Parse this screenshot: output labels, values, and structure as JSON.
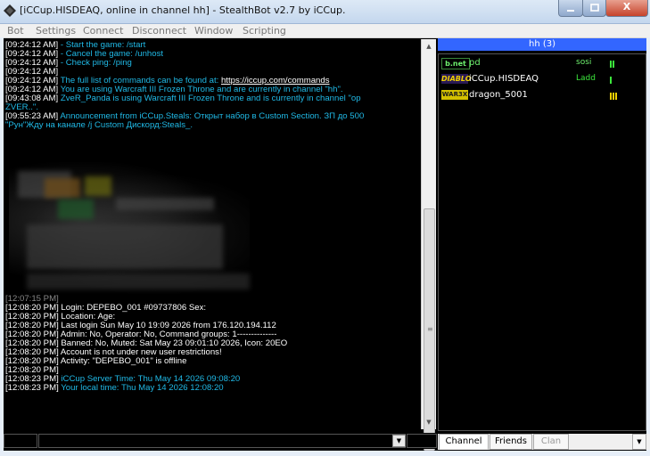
{
  "window": {
    "title": "[iCCup.HISDEAQ, online in channel hh] - StealthBot v2.7 by iCCup.",
    "min_label": "",
    "max_label": "",
    "close_label": "X"
  },
  "menu": [
    "Bot",
    "Settings",
    "Connect",
    "Disconnect",
    "Window",
    "Scripting"
  ],
  "chat": {
    "lines": [
      {
        "ts": "[09:24:12 AM]",
        "text": " - Start the game: /start",
        "color": "cyan"
      },
      {
        "ts": "[09:24:12 AM]",
        "text": " - Cancel the game: /unhost",
        "color": "cyan"
      },
      {
        "ts": "[09:24:12 AM]",
        "text": " - Check ping: /ping",
        "color": "cyan"
      },
      {
        "ts": "[09:24:12 AM]",
        "text": "",
        "color": "cyan"
      },
      {
        "ts": "[09:24:12 AM]",
        "text": " The full list of commands can be found at: ",
        "color": "cyan",
        "link": "https://iccup.com/commands"
      },
      {
        "ts": "[09:24:12 AM]",
        "text": " You are using Warcraft III Frozen Throne and are currently in channel \"hh\".",
        "color": "cyan"
      },
      {
        "ts": "[09:43:08 AM]",
        "text": " ZveR_Panda is using Warcraft III Frozen Throne and is currently in channel \"op",
        "color": "cyan"
      },
      {
        "ts": "",
        "text": "  ZVER..\".",
        "color": "cyan"
      },
      {
        "ts": "[09:55:23 AM]",
        "text": " Announcement from iCCup.Steals: Открыт набор в Custom Section. ЗП до 500",
        "color": "cyan"
      },
      {
        "ts": "",
        "text": "  \"Рун\"Жду на канале /j Custom  Дискорд:Steals_.",
        "color": "cyan"
      },
      {
        "ts": "[12:07:15 PM]",
        "text": "",
        "color": "cyan"
      },
      {
        "ts": "[12:08:20 PM]",
        "text": " Login: DEPEBO_001       #09737806 Sex:",
        "color": "white"
      },
      {
        "ts": "[12:08:20 PM]",
        "text": " Location:                     Age:",
        "color": "white"
      },
      {
        "ts": "[12:08:20 PM]",
        "text": " Last login Sun May 10 19:09 2026 from 176.120.194.112",
        "color": "white"
      },
      {
        "ts": "[12:08:20 PM]",
        "text": " Admin: No, Operator: No, Command groups: 1--------------",
        "color": "white"
      },
      {
        "ts": "[12:08:20 PM]",
        "text": " Banned: No, Muted: Sat May 23 09:01:10 2026, Icon: 20EO",
        "color": "white"
      },
      {
        "ts": "[12:08:20 PM]",
        "text": " Account is not under new user restrictions!",
        "color": "white"
      },
      {
        "ts": "[12:08:20 PM]",
        "text": " Activity: \"DEPEBO_001\" is offline",
        "color": "white"
      },
      {
        "ts": "[12:08:20 PM]",
        "text": "",
        "color": "white"
      },
      {
        "ts": "[12:08:23 PM]",
        "text": " iCCup Server Time: Thu May 14 2026 09:08:20",
        "color": "cyan"
      },
      {
        "ts": "[12:08:23 PM]",
        "text": " Your local time: Thu May 14 2026 12:08:20",
        "color": "cyan"
      }
    ]
  },
  "input": {
    "text_value": ""
  },
  "channel": {
    "header": "hh (3)",
    "users": [
      {
        "badge": "b.net",
        "badge_color": "#6ef06e",
        "name": "pd",
        "name_color": "#6ef06e",
        "flag": "sosi",
        "flag_color": "#6ef06e",
        "ping_color": "#3ce83c",
        "ping_bars": 2
      },
      {
        "badge": "DIABLO",
        "badge_color": "#d4c000",
        "name": "iCCup.HISDEAQ",
        "name_color": "#ffffff",
        "flag": "Ladd",
        "flag_color": "#3ce83c",
        "ping_color": "#3ce83c",
        "ping_bars": 1
      },
      {
        "badge": "WAR3X",
        "badge_color": "#d4c000",
        "name": "dragon_5001",
        "name_color": "#ffffff",
        "flag": "",
        "flag_color": "#ffffff",
        "ping_color": "#f0d000",
        "ping_bars": 3
      }
    ]
  },
  "tabs": [
    "Channel",
    "Friends",
    "Clan"
  ],
  "colors": {
    "cyan": "#20b9e6",
    "white": "#ffffff",
    "header_blue": "#3366ff"
  }
}
